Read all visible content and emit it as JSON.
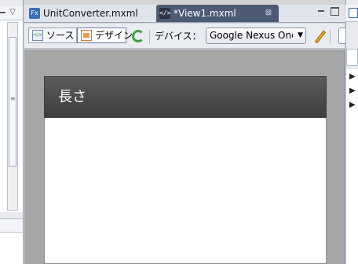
{
  "editor_tabs": [
    {
      "label": "UnitConverter.mxml",
      "icon": "mxml-file-icon",
      "active": false
    },
    {
      "label": "*View1.mxml",
      "icon": "mxml-view-icon",
      "active": true
    }
  ],
  "tab_close_glyph": "⊠",
  "toolbar": {
    "source_label": "ソース",
    "design_label": "デザイン",
    "device_label": "デバイス：",
    "device_value": "Google Nexus One"
  },
  "canvas": {
    "app_title": "長さ"
  },
  "colors": {
    "active_tab": "#4c5a74",
    "actionbar": "#4a4a4a",
    "canvas_bg": "#a6a6a6"
  },
  "icons": [
    "source-icon",
    "design-icon",
    "refresh-icon",
    "pencil-icon",
    "chevron-down-icon"
  ]
}
